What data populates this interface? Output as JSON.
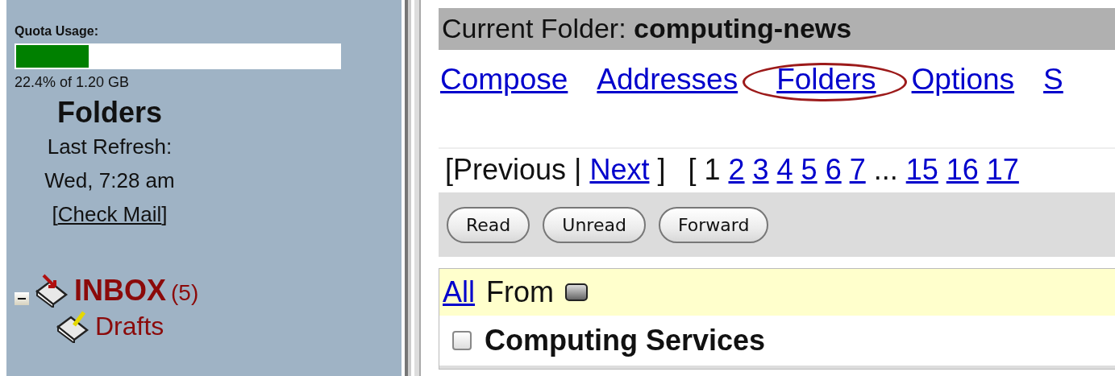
{
  "sidebar": {
    "quota": {
      "label": "Quota Usage:",
      "level": 0.224,
      "reading": "22.4% of 1.20 GB"
    },
    "title": "Folders",
    "refresh_label": "Last Refresh:",
    "refresh_time": "Wed, 7:28 am",
    "check_mail": {
      "open": "[",
      "label": "Check Mail",
      "close": "]"
    },
    "folders": [
      {
        "name": "INBOX",
        "count": "(5)",
        "kind": "inbox",
        "expanded": true,
        "children": [
          {
            "name": "Drafts",
            "kind": "drafts"
          }
        ]
      }
    ]
  },
  "current_folder": {
    "label": "Current Folder:",
    "name": "computing-news"
  },
  "nav_links": [
    {
      "label": "Compose",
      "circled": false
    },
    {
      "label": "Addresses",
      "circled": false
    },
    {
      "label": "Folders",
      "circled": true
    },
    {
      "label": "Options",
      "circled": false
    },
    {
      "label": "S",
      "circled": false
    }
  ],
  "pagination": [
    {
      "kind": "text",
      "text": "[Previous |"
    },
    {
      "kind": "link",
      "text": "Next"
    },
    {
      "kind": "text",
      "text": "]"
    },
    {
      "kind": "text",
      "text": "[ 1"
    },
    {
      "kind": "link",
      "text": "2"
    },
    {
      "kind": "link",
      "text": "3"
    },
    {
      "kind": "link",
      "text": "4"
    },
    {
      "kind": "link",
      "text": "5"
    },
    {
      "kind": "link",
      "text": "6"
    },
    {
      "kind": "link",
      "text": "7"
    },
    {
      "kind": "text",
      "text": "..."
    },
    {
      "kind": "link",
      "text": "15"
    },
    {
      "kind": "link",
      "text": "16"
    },
    {
      "kind": "link",
      "text": "17"
    }
  ],
  "buttons": [
    "Read",
    "Unread",
    "Forward"
  ],
  "table": {
    "select_all": "All",
    "columns": [
      {
        "label": "From"
      }
    ],
    "rows": [
      {
        "from": "Computing Services",
        "checked": false,
        "unread": true
      }
    ]
  }
}
